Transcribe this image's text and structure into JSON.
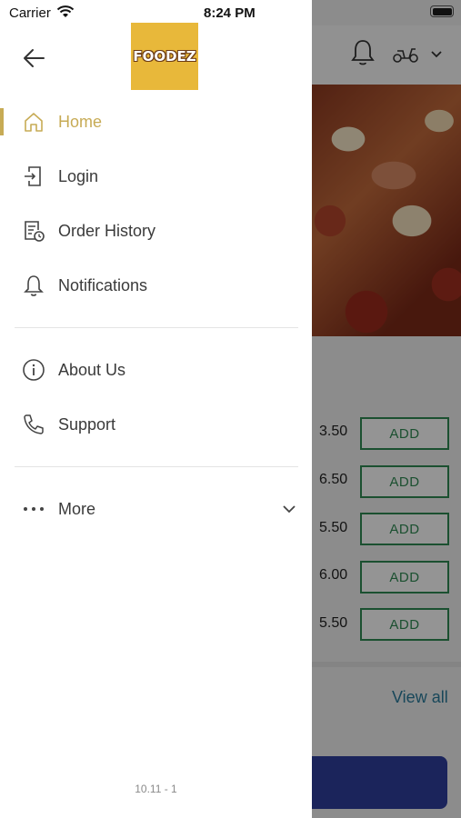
{
  "status": {
    "carrier": "Carrier",
    "time": "8:24 PM"
  },
  "logo": {
    "text": "FOODEZ",
    "color": "#e8b83a"
  },
  "menu": {
    "items": [
      {
        "label": "Home",
        "icon": "home-icon",
        "active": true
      },
      {
        "label": "Login",
        "icon": "login-icon"
      },
      {
        "label": "Order History",
        "icon": "order-history-icon"
      },
      {
        "label": "Notifications",
        "icon": "bell-icon"
      },
      {
        "label": "About Us",
        "icon": "info-icon"
      },
      {
        "label": "Support",
        "icon": "phone-icon"
      },
      {
        "label": "More",
        "icon": "more-dots-icon"
      }
    ],
    "accent_color": "#c7ab55"
  },
  "version": "10.11 - 1",
  "background": {
    "prices": [
      "3.50",
      "6.50",
      "5.50",
      "6.00",
      "5.50"
    ],
    "add_label": "ADD",
    "view_all": "View all"
  }
}
